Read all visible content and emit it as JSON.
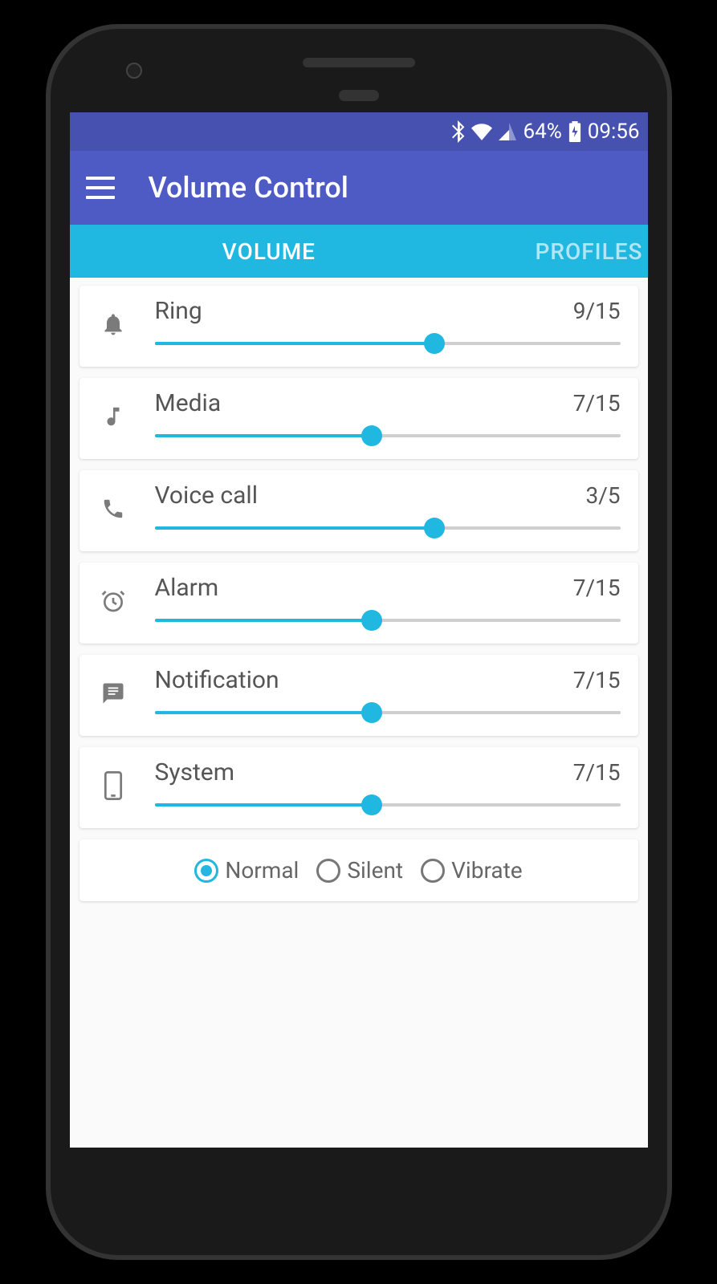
{
  "statusbar": {
    "battery": "64%",
    "time": "09:56"
  },
  "appbar": {
    "title": "Volume Control"
  },
  "tabs": {
    "volume": "VOLUME",
    "profiles": "PROFILES"
  },
  "sliders": [
    {
      "icon": "bell",
      "label": "Ring",
      "value": 9,
      "max": 15,
      "display": "9/15"
    },
    {
      "icon": "note",
      "label": "Media",
      "value": 7,
      "max": 15,
      "display": "7/15"
    },
    {
      "icon": "phone",
      "label": "Voice call",
      "value": 3,
      "max": 5,
      "display": "3/5"
    },
    {
      "icon": "alarm",
      "label": "Alarm",
      "value": 7,
      "max": 15,
      "display": "7/15"
    },
    {
      "icon": "message",
      "label": "Notification",
      "value": 7,
      "max": 15,
      "display": "7/15"
    },
    {
      "icon": "device",
      "label": "System",
      "value": 7,
      "max": 15,
      "display": "7/15"
    }
  ],
  "modes": [
    {
      "label": "Normal",
      "selected": true
    },
    {
      "label": "Silent",
      "selected": false
    },
    {
      "label": "Vibrate",
      "selected": false
    }
  ]
}
